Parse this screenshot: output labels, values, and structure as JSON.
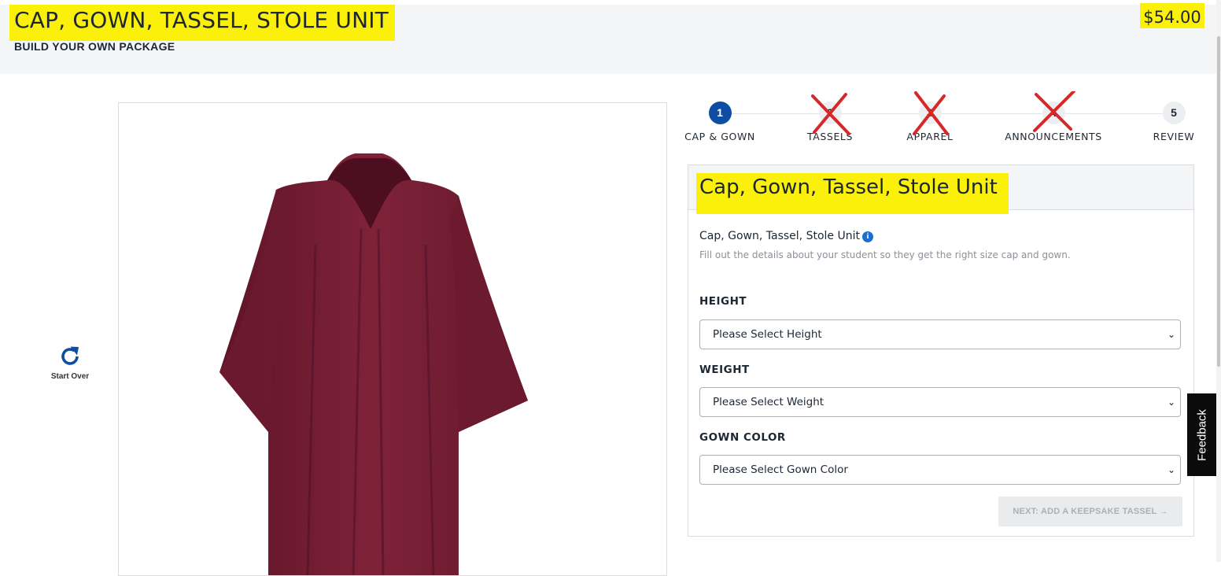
{
  "header": {
    "package_title": "CAP, GOWN, TASSEL, STOLE UNIT",
    "package_subtitle": "BUILD YOUR OWN PACKAGE",
    "price": "$54.00",
    "highlight_color": "#fbf00a"
  },
  "start_over": {
    "label": "Start Over",
    "icon": "refresh-icon",
    "icon_color": "#0d4ea3"
  },
  "product_image": {
    "description_icon": "graduation-gown-image",
    "gown_color": "#7a1f35"
  },
  "stepper": {
    "steps": [
      {
        "number": "1",
        "label": "CAP & GOWN",
        "state": "active"
      },
      {
        "number": "2",
        "label": "TASSELS",
        "state": "crossed-out"
      },
      {
        "number": "3",
        "label": "APPAREL",
        "state": "crossed-out"
      },
      {
        "number": "4",
        "label": "ANNOUNCEMENTS",
        "state": "crossed-out"
      },
      {
        "number": "5",
        "label": "REVIEW",
        "state": "inactive"
      }
    ],
    "active_color": "#0d4ea3",
    "cross_color": "#d62828"
  },
  "form": {
    "card_title": "Cap, Gown, Tassel, Stole Unit",
    "unit_label": "Cap, Gown, Tassel, Stole Unit",
    "helper_text": "Fill out the details about your student so they get the right size cap and gown.",
    "height": {
      "label": "HEIGHT",
      "value": "Please Select Height"
    },
    "weight": {
      "label": "WEIGHT",
      "value": "Please Select Weight"
    },
    "gown_color": {
      "label": "GOWN COLOR",
      "value": "Please Select Gown Color"
    },
    "next_button": "NEXT: ADD A KEEPSAKE TASSEL"
  },
  "feedback": {
    "label": "Feedback"
  }
}
